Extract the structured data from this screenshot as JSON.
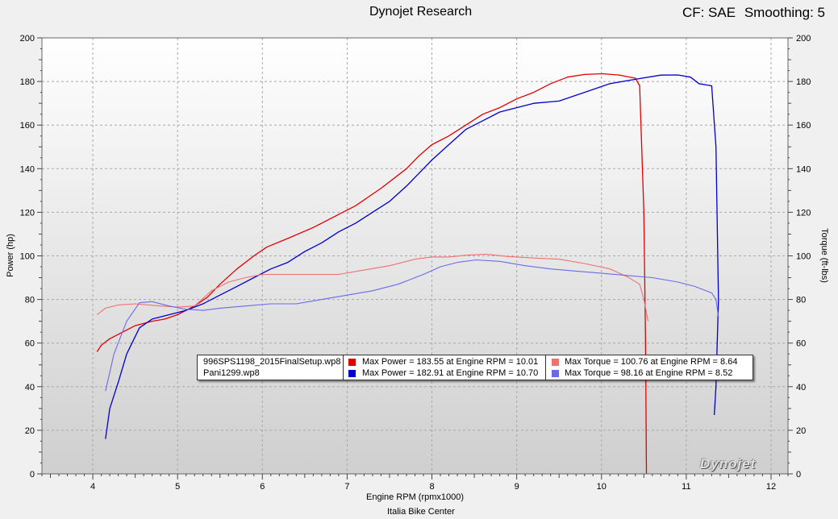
{
  "header": {
    "title": "Dynojet Research",
    "cf_label": "CF: SAE",
    "smoothing_label": "Smoothing: 5"
  },
  "footer": {
    "shop": "Italia Bike Center"
  },
  "watermark": "Dynojet",
  "legend": {
    "runs": [
      {
        "file": "996SPS1198_2015FinalSetup.wp8",
        "power_label": "Max Power = 183.55 at Engine RPM = 10.01",
        "torque_label": "Max Torque = 100.76 at Engine RPM = 8.64",
        "power_color": "#e00000",
        "torque_color": "#f07070"
      },
      {
        "file": "Pani1299.wp8",
        "power_label": "Max Power = 182.91 at Engine RPM = 10.70",
        "torque_label": "Max Torque = 98.16 at Engine RPM = 8.52",
        "power_color": "#0000cc",
        "torque_color": "#6a6ae8"
      }
    ]
  },
  "chart_data": {
    "type": "line",
    "title": "Dynojet Research",
    "xlabel": "Engine RPM (rpmx1000)",
    "ylabel": "Power (hp)",
    "y2label": "Torque (ft-lbs)",
    "xlim": [
      3.4,
      12.2
    ],
    "ylim": [
      0,
      200
    ],
    "y2lim": [
      0,
      200
    ],
    "xticks": [
      4,
      5,
      6,
      7,
      8,
      9,
      10,
      11,
      12
    ],
    "yticks": [
      0,
      20,
      40,
      60,
      80,
      100,
      120,
      140,
      160,
      180,
      200
    ],
    "y2ticks": [
      0,
      20,
      40,
      60,
      80,
      100,
      120,
      140,
      160,
      180,
      200
    ],
    "grid": true,
    "legend_position": "bottom-center",
    "series": [
      {
        "name": "Max Power = 183.55 at Engine RPM = 10.01",
        "color": "#e00000",
        "axis": "left",
        "points": [
          [
            4.05,
            56
          ],
          [
            4.1,
            59
          ],
          [
            4.2,
            62
          ],
          [
            4.35,
            65
          ],
          [
            4.5,
            68
          ],
          [
            4.7,
            70
          ],
          [
            4.85,
            71
          ],
          [
            5.0,
            73
          ],
          [
            5.2,
            77
          ],
          [
            5.35,
            81
          ],
          [
            5.5,
            87
          ],
          [
            5.7,
            94
          ],
          [
            5.9,
            100
          ],
          [
            6.05,
            104
          ],
          [
            6.3,
            108
          ],
          [
            6.6,
            113
          ],
          [
            6.9,
            119
          ],
          [
            7.1,
            123
          ],
          [
            7.4,
            131
          ],
          [
            7.7,
            140
          ],
          [
            7.85,
            146
          ],
          [
            8.0,
            151
          ],
          [
            8.2,
            155
          ],
          [
            8.4,
            160
          ],
          [
            8.6,
            165
          ],
          [
            8.8,
            168
          ],
          [
            9.0,
            172
          ],
          [
            9.2,
            175
          ],
          [
            9.4,
            179
          ],
          [
            9.6,
            182
          ],
          [
            9.8,
            183.2
          ],
          [
            10.01,
            183.55
          ],
          [
            10.2,
            183
          ],
          [
            10.4,
            181.5
          ],
          [
            10.45,
            178
          ],
          [
            10.5,
            120
          ],
          [
            10.52,
            60
          ],
          [
            10.53,
            0
          ]
        ]
      },
      {
        "name": "Max Power = 182.91 at Engine RPM = 10.70",
        "color": "#0000cc",
        "axis": "left",
        "points": [
          [
            4.15,
            16
          ],
          [
            4.2,
            30
          ],
          [
            4.3,
            42
          ],
          [
            4.4,
            55
          ],
          [
            4.55,
            67
          ],
          [
            4.7,
            71
          ],
          [
            4.9,
            73
          ],
          [
            5.1,
            75
          ],
          [
            5.3,
            78
          ],
          [
            5.5,
            82
          ],
          [
            5.7,
            86
          ],
          [
            5.9,
            90
          ],
          [
            6.1,
            94
          ],
          [
            6.3,
            97
          ],
          [
            6.5,
            102
          ],
          [
            6.7,
            106
          ],
          [
            6.9,
            111
          ],
          [
            7.1,
            115
          ],
          [
            7.3,
            120
          ],
          [
            7.5,
            125
          ],
          [
            7.7,
            132
          ],
          [
            7.85,
            138
          ],
          [
            8.0,
            144
          ],
          [
            8.2,
            151
          ],
          [
            8.4,
            158
          ],
          [
            8.6,
            162
          ],
          [
            8.8,
            166
          ],
          [
            9.0,
            168
          ],
          [
            9.2,
            170
          ],
          [
            9.5,
            171
          ],
          [
            9.8,
            175
          ],
          [
            10.1,
            179
          ],
          [
            10.4,
            181
          ],
          [
            10.7,
            182.91
          ],
          [
            10.9,
            183
          ],
          [
            11.05,
            182
          ],
          [
            11.15,
            179
          ],
          [
            11.3,
            178
          ],
          [
            11.35,
            150
          ],
          [
            11.38,
            80
          ],
          [
            11.35,
            40
          ],
          [
            11.33,
            27
          ]
        ]
      },
      {
        "name": "Max Torque = 100.76 at Engine RPM = 8.64",
        "color": "#f07070",
        "axis": "right",
        "points": [
          [
            4.05,
            73
          ],
          [
            4.15,
            76
          ],
          [
            4.3,
            77.5
          ],
          [
            4.5,
            78
          ],
          [
            4.8,
            77
          ],
          [
            5.0,
            76.5
          ],
          [
            5.2,
            77
          ],
          [
            5.4,
            84
          ],
          [
            5.6,
            88
          ],
          [
            5.8,
            90
          ],
          [
            6.0,
            91.5
          ],
          [
            6.3,
            91.5
          ],
          [
            6.6,
            91.5
          ],
          [
            6.9,
            91.5
          ],
          [
            7.2,
            93.5
          ],
          [
            7.5,
            95.5
          ],
          [
            7.8,
            98.5
          ],
          [
            8.0,
            99.5
          ],
          [
            8.2,
            99.5
          ],
          [
            8.4,
            100.3
          ],
          [
            8.64,
            100.76
          ],
          [
            8.9,
            99.7
          ],
          [
            9.2,
            99
          ],
          [
            9.5,
            98.5
          ],
          [
            9.8,
            96.5
          ],
          [
            10.1,
            94
          ],
          [
            10.3,
            90.5
          ],
          [
            10.45,
            87
          ],
          [
            10.5,
            80
          ],
          [
            10.55,
            70
          ]
        ]
      },
      {
        "name": "Max Torque = 98.16 at Engine RPM = 8.52",
        "color": "#6a6ae8",
        "axis": "right",
        "points": [
          [
            4.15,
            38
          ],
          [
            4.25,
            55
          ],
          [
            4.4,
            70
          ],
          [
            4.55,
            78.5
          ],
          [
            4.7,
            79
          ],
          [
            4.9,
            77
          ],
          [
            5.1,
            75.5
          ],
          [
            5.3,
            75
          ],
          [
            5.5,
            76
          ],
          [
            5.8,
            77
          ],
          [
            6.1,
            78
          ],
          [
            6.4,
            78
          ],
          [
            6.7,
            80
          ],
          [
            7.0,
            82
          ],
          [
            7.3,
            84
          ],
          [
            7.6,
            87
          ],
          [
            7.9,
            91.5
          ],
          [
            8.1,
            95
          ],
          [
            8.3,
            97
          ],
          [
            8.52,
            98.16
          ],
          [
            8.8,
            97.5
          ],
          [
            9.1,
            95.5
          ],
          [
            9.4,
            94
          ],
          [
            9.7,
            93
          ],
          [
            10.0,
            92
          ],
          [
            10.3,
            91
          ],
          [
            10.6,
            90
          ],
          [
            10.9,
            88
          ],
          [
            11.1,
            86
          ],
          [
            11.3,
            83
          ],
          [
            11.35,
            80
          ],
          [
            11.38,
            72
          ]
        ]
      }
    ]
  }
}
